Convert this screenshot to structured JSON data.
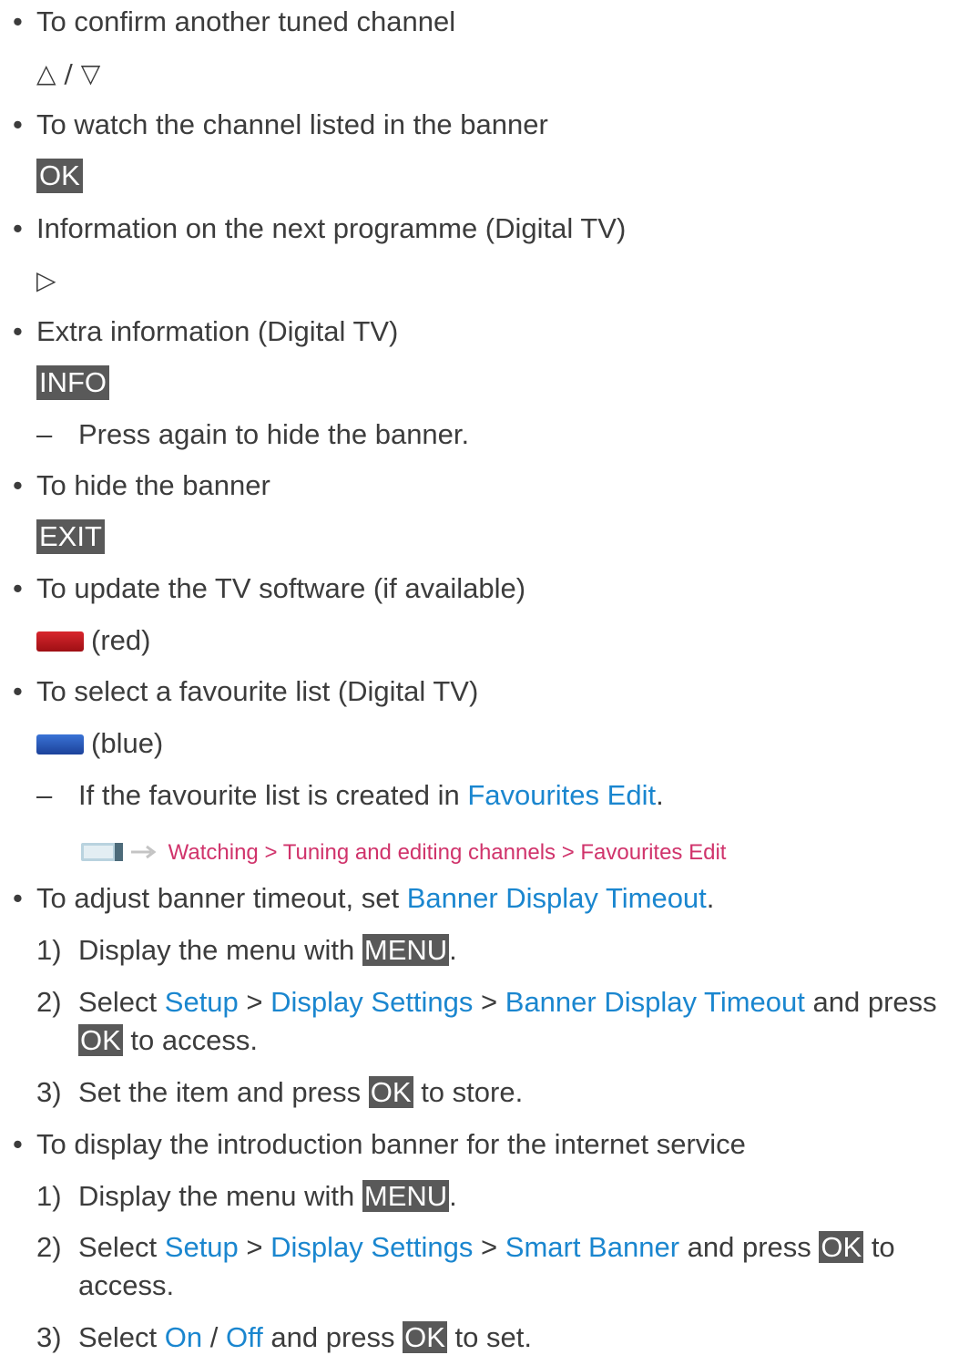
{
  "colors": {
    "link": "#1a86cf",
    "path": "#d0336b",
    "key_bg": "#595959",
    "red": "#c0171d",
    "blue": "#2757b8"
  },
  "bullets": {
    "b1": "To confirm another tuned channel",
    "b2": "To watch the channel listed in the banner",
    "b3": "Information on the next programme (Digital TV)",
    "b4": "Extra information (Digital TV)",
    "b5": "To hide the banner",
    "b6": "To update the TV software (if available)",
    "b7": "To select a favourite list (Digital TV)",
    "b8_text": "To adjust banner timeout, set ",
    "b8_link": "Banner Display Timeout",
    "b9": "To display the introduction banner for the internet service"
  },
  "keys": {
    "up_down": "△ / ▽",
    "ok": "OK",
    "right": "▷",
    "info": "INFO",
    "exit": "EXIT",
    "menu": "MENU",
    "red_label": "(red)",
    "blue_label": "(blue)"
  },
  "notes": {
    "press_again": "Press again to hide the banner.",
    "fav_text": "If the favourite list is created in ",
    "fav_link": "Favourites Edit",
    "fav_path": "Watching > Tuning and editing channels > Favourites Edit"
  },
  "steps": {
    "s1_num": "1)",
    "s1_text": "Display the menu with ",
    "s2_num": "2)",
    "s2_pre": "Select ",
    "setup": "Setup",
    "sep": " > ",
    "display_settings": "Display Settings",
    "banner_timeout": "Banner Display Timeout",
    "s2_post": " and press",
    "s2_cont": " to access.",
    "s3_num": "3)",
    "s3_pre": "Set the item and press ",
    "s3_post": " to store.",
    "t1_num": "1)",
    "t2_num": "2)",
    "smart_banner": "Smart Banner",
    "t2_post": " and press ",
    "t2_to": " to",
    "t2_cont": "access.",
    "t3_num": "3)",
    "t3_pre": "Select ",
    "on": "On",
    "slash": " / ",
    "off": "Off",
    "t3_mid": " and press ",
    "t3_post": " to set."
  },
  "misc": {
    "bullet": "•",
    "dash": "–",
    "period": "."
  }
}
